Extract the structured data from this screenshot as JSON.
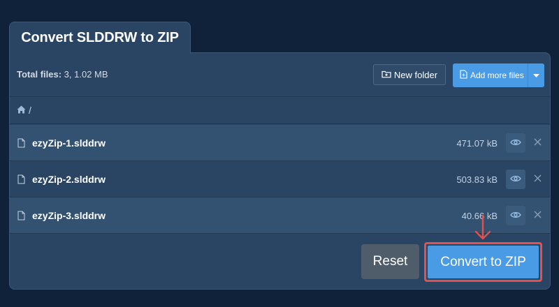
{
  "tab": {
    "title": "Convert SLDDRW to ZIP"
  },
  "toolbar": {
    "total_label": "Total files:",
    "total_value": "3, 1.02 MB",
    "new_folder_label": "New folder",
    "add_more_label": "Add more files"
  },
  "path": {
    "separator": "/"
  },
  "files": [
    {
      "name": "ezyZip-1.slddrw",
      "size": "471.07 kB"
    },
    {
      "name": "ezyZip-2.slddrw",
      "size": "503.83 kB"
    },
    {
      "name": "ezyZip-3.slddrw",
      "size": "40.66 kB"
    }
  ],
  "actions": {
    "reset_label": "Reset",
    "convert_label": "Convert to ZIP"
  },
  "colors": {
    "background": "#10223a",
    "panel": "#2a4563",
    "accent": "#4a9be6",
    "highlight": "#e0514f"
  },
  "icons": {
    "new_folder": "folder-plus-icon",
    "add_files": "file-plus-icon",
    "dropdown": "caret-down-icon",
    "home": "home-icon",
    "file": "file-icon",
    "preview": "eye-icon",
    "remove": "close-icon",
    "pointer": "arrow-down-icon"
  }
}
